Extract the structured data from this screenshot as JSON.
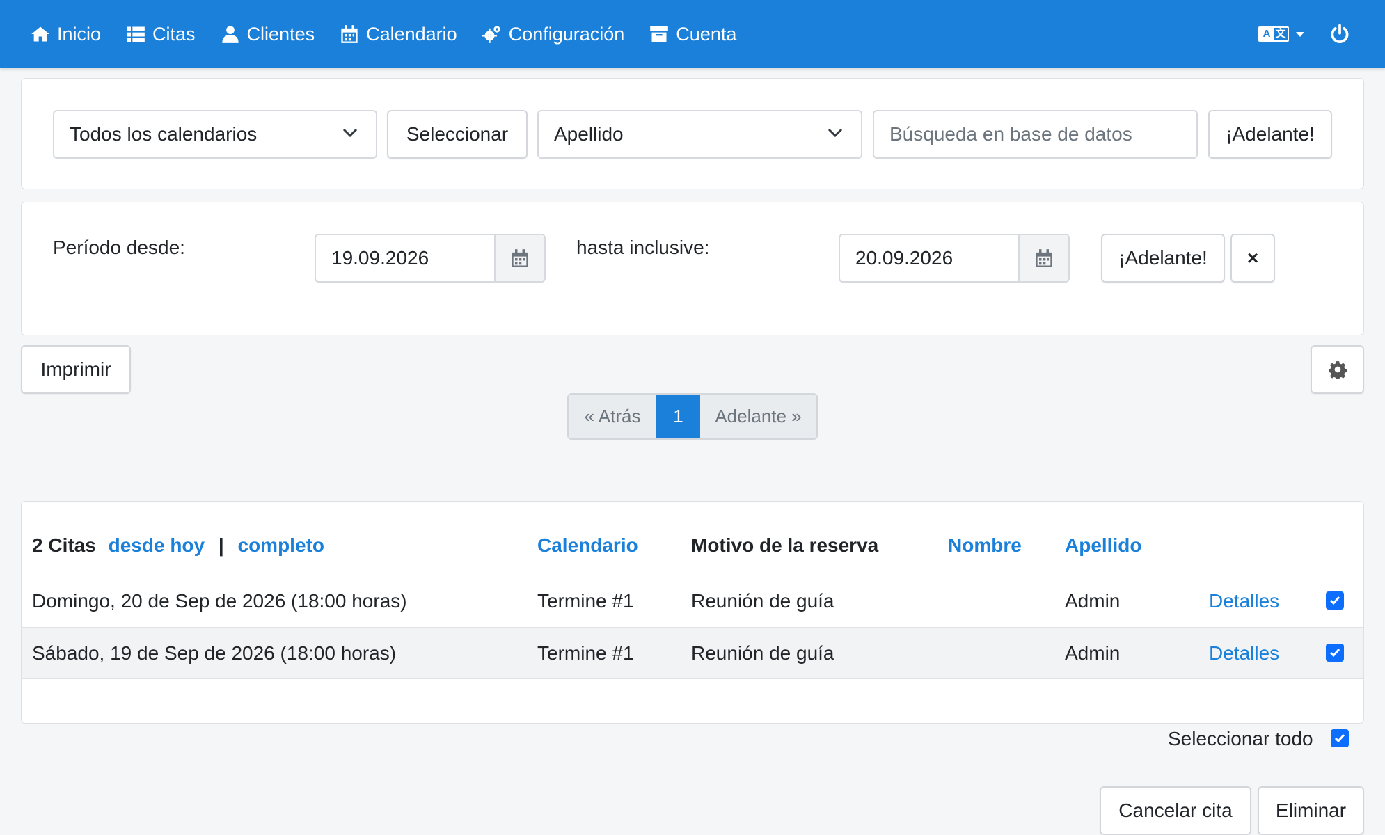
{
  "navbar": {
    "items": [
      {
        "label": "Inicio",
        "icon": "home-icon"
      },
      {
        "label": "Citas",
        "icon": "list-icon"
      },
      {
        "label": "Clientes",
        "icon": "user-icon"
      },
      {
        "label": "Calendario",
        "icon": "calendar-icon"
      },
      {
        "label": "Configuración",
        "icon": "gears-icon"
      },
      {
        "label": "Cuenta",
        "icon": "archive-icon"
      }
    ],
    "language_icon": "language-icon",
    "power_icon": "power-icon",
    "background_color": "#1a80d9"
  },
  "search": {
    "calendar_select": "Todos los calendarios",
    "select_button": "Seleccionar",
    "field_select": "Apellido",
    "search_placeholder": "Búsqueda en base de datos",
    "go_button": "¡Adelante!"
  },
  "period": {
    "from_label": "Período desde:",
    "from_value": "19.09.2026",
    "to_label": "hasta inclusive:",
    "to_value": "20.09.2026",
    "go_button": "¡Adelante!",
    "clear_button": "×"
  },
  "toolbar": {
    "print_button": "Imprimir",
    "settings_icon": "gear-icon"
  },
  "pagination": {
    "prev": "« Atrás",
    "current": "1",
    "next": "Adelante »"
  },
  "appointments": {
    "count_label": "2 Citas",
    "filter_today": "desde hoy",
    "separator": "|",
    "filter_all": "completo",
    "headers": {
      "calendar": "Calendario",
      "reason": "Motivo de la reserva",
      "first_name": "Nombre",
      "last_name": "Apellido"
    },
    "rows": [
      {
        "date": "Domingo, 20 de Sep de 2026 (18:00 horas)",
        "calendar": "Termine #1",
        "reason": "Reunión de guía",
        "first_name": "",
        "last_name": "Admin",
        "details": "Detalles",
        "checked": true
      },
      {
        "date": "Sábado, 19 de Sep de 2026 (18:00 horas)",
        "calendar": "Termine #1",
        "reason": "Reunión de guía",
        "first_name": "",
        "last_name": "Admin",
        "details": "Detalles",
        "checked": true
      }
    ]
  },
  "footer": {
    "select_all": "Seleccionar todo",
    "cancel_button": "Cancelar cita",
    "delete_button": "Eliminar"
  }
}
